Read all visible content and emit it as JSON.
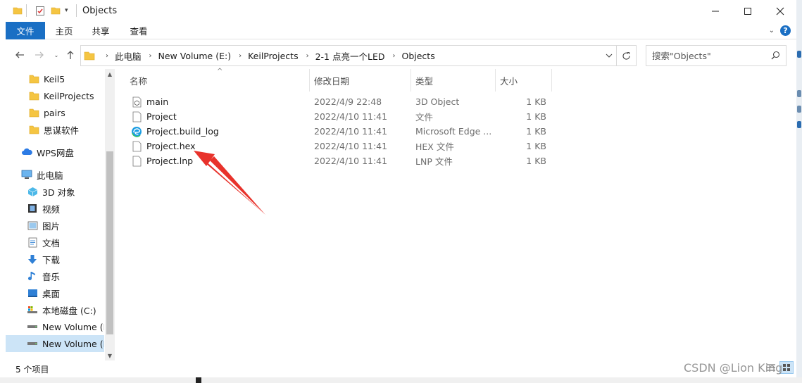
{
  "window": {
    "title": "Objects"
  },
  "ribbon": {
    "tabs": [
      {
        "label": "文件"
      },
      {
        "label": "主页"
      },
      {
        "label": "共享"
      },
      {
        "label": "查看"
      }
    ]
  },
  "address": {
    "crumbs": [
      "此电脑",
      "New Volume (E:)",
      "KeilProjects",
      "2-1 点亮一个LED",
      "Objects"
    ]
  },
  "search": {
    "placeholder": "搜索\"Objects\""
  },
  "sidebar": {
    "items": [
      {
        "label": "Keil5",
        "icon": "folder-icon"
      },
      {
        "label": "KeilProjects",
        "icon": "folder-icon"
      },
      {
        "label": "pairs",
        "icon": "folder-icon"
      },
      {
        "label": "思谋软件",
        "icon": "folder-icon"
      },
      {
        "label": "WPS网盘",
        "icon": "cloud-icon"
      },
      {
        "label": "此电脑",
        "icon": "computer-icon"
      },
      {
        "label": "3D 对象",
        "icon": "cube-icon"
      },
      {
        "label": "视频",
        "icon": "video-icon"
      },
      {
        "label": "图片",
        "icon": "picture-icon"
      },
      {
        "label": "文档",
        "icon": "document-icon"
      },
      {
        "label": "下载",
        "icon": "download-icon"
      },
      {
        "label": "音乐",
        "icon": "music-icon"
      },
      {
        "label": "桌面",
        "icon": "desktop-icon"
      },
      {
        "label": "本地磁盘 (C:)",
        "icon": "system-drive-icon"
      },
      {
        "label": "New Volume (D",
        "icon": "drive-icon"
      },
      {
        "label": "New Volume (E",
        "icon": "drive-icon"
      }
    ]
  },
  "columns": {
    "name": "名称",
    "date": "修改日期",
    "type": "类型",
    "size": "大小"
  },
  "files": [
    {
      "name": "main",
      "date": "2022/4/9 22:48",
      "type": "3D Object",
      "size": "1 KB",
      "icon": "3d-object-file-icon"
    },
    {
      "name": "Project",
      "date": "2022/4/10 11:41",
      "type": "文件",
      "size": "1 KB",
      "icon": "file-icon"
    },
    {
      "name": "Project.build_log",
      "date": "2022/4/10 11:41",
      "type": "Microsoft Edge ...",
      "size": "1 KB",
      "icon": "edge-icon"
    },
    {
      "name": "Project.hex",
      "date": "2022/4/10 11:41",
      "type": "HEX 文件",
      "size": "1 KB",
      "icon": "file-icon"
    },
    {
      "name": "Project.lnp",
      "date": "2022/4/10 11:41",
      "type": "LNP 文件",
      "size": "1 KB",
      "icon": "file-icon"
    }
  ],
  "status": {
    "count": "5 个项目"
  },
  "watermark": "CSDN @Lion King",
  "colors": {
    "accent": "#1a6fc4",
    "selection": "#cce4f7",
    "annotation_arrow": "#e8322b"
  }
}
